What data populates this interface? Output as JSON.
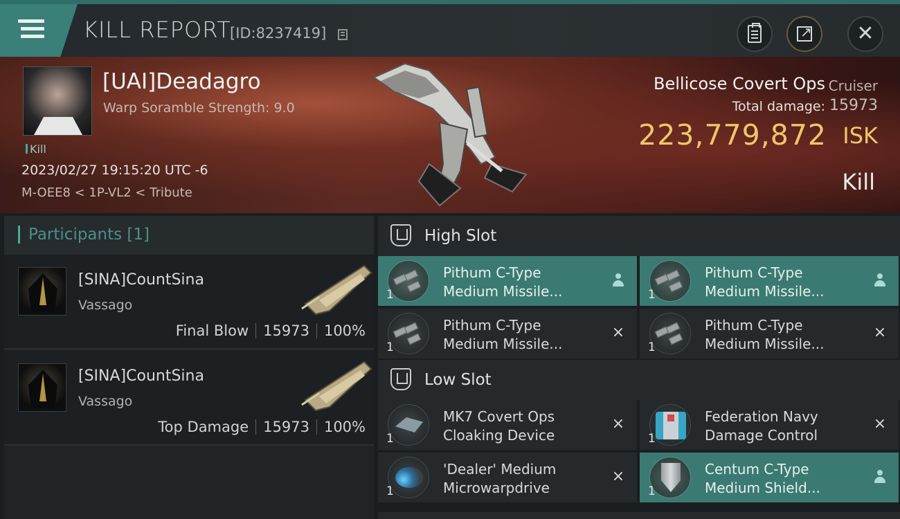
{
  "header": {
    "title": "KILL REPORT",
    "kill_id": "[ID:8237419]",
    "icons": [
      "menu-icon",
      "copy-icon",
      "clipboard-icon",
      "share-icon",
      "close-icon"
    ]
  },
  "victim": {
    "name": "[UAI]Deadagro",
    "scramble": "Warp Soramble Strength: 9.0",
    "tag": "Kill",
    "datetime": "2023/02/27 19:15:20 UTC -6",
    "location": "M-OEE8 < 1P-VL2 < Tribute",
    "ship_name": "Bellicose Covert Ops",
    "ship_class": "Cruiser",
    "damage_label": "Total damage:",
    "damage_value": "15973",
    "isk_value": "223,779,872",
    "isk_unit": "ISK",
    "result": "Kill"
  },
  "participants": {
    "title": "Participants [1]",
    "rows": [
      {
        "name": "[SINA]CountSina",
        "ship": "Vassago",
        "role": "Final Blow",
        "damage": "15973",
        "percent": "100%"
      },
      {
        "name": "[SINA]CountSina",
        "ship": "Vassago",
        "role": "Top Damage",
        "damage": "15973",
        "percent": "100%"
      }
    ]
  },
  "fitting": {
    "high_slot": {
      "title": "High Slot",
      "modules": [
        {
          "line1": "Pithum C-Type",
          "line2": "Medium Missile...",
          "qty": "1",
          "status": "person-icon",
          "highlight": true
        },
        {
          "line1": "Pithum C-Type",
          "line2": "Medium Missile...",
          "qty": "1",
          "status": "person-icon",
          "highlight": true
        },
        {
          "line1": "Pithum C-Type",
          "line2": "Medium Missile...",
          "qty": "1",
          "status": "×",
          "highlight": false
        },
        {
          "line1": "Pithum C-Type",
          "line2": "Medium Missile...",
          "qty": "1",
          "status": "×",
          "highlight": false
        }
      ]
    },
    "low_slot": {
      "title": "Low Slot",
      "modules": [
        {
          "line1": "MK7 Covert Ops",
          "line2": "Cloaking Device",
          "qty": "1",
          "status": "×",
          "highlight": false
        },
        {
          "line1": "Federation Navy",
          "line2": "Damage Control",
          "qty": "1",
          "status": "×",
          "highlight": false
        },
        {
          "line1": "'Dealer' Medium",
          "line2": "Microwarpdrive",
          "qty": "1",
          "status": "×",
          "highlight": false
        },
        {
          "line1": "Centum C-Type",
          "line2": "Medium Shield...",
          "qty": "1",
          "status": "person-icon",
          "highlight": true
        }
      ]
    }
  },
  "colors": {
    "accent_teal": "#3a7f78",
    "isk_gold": "#f0c66a",
    "highlight_module": "#3a7a72"
  }
}
